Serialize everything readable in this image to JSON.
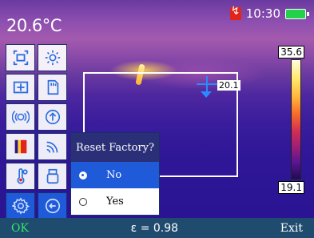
{
  "header": {
    "center_temp": "20.6°C",
    "time": "10:30",
    "sd_icon": "sd-card-icon",
    "battery_icon": "battery-icon"
  },
  "measurement": {
    "spot_value": "20.1"
  },
  "scale": {
    "max": "35.6",
    "min": "19.1"
  },
  "menu_icons": [
    "area-measure-icon",
    "brightness-icon",
    "center-spot-icon",
    "sd-card-icon",
    "emissivity-icon",
    "upload-icon",
    "palette-icon",
    "wifi-icon",
    "temperature-unit-icon",
    "usb-storage-icon",
    "settings-gear-icon",
    "back-icon"
  ],
  "reset_dialog": {
    "title": "Reset Factory?",
    "options": [
      "No",
      "Yes"
    ],
    "selected": "No"
  },
  "bottom_bar": {
    "ok": "OK",
    "emissivity": "ε = 0.98",
    "exit": "Exit"
  },
  "colors": {
    "selected_blue": "#1f5ad9",
    "dialog_title_bg": "#2a2f77",
    "bottom_bar_bg": "#1f4b6e",
    "ok_green": "#35e86a"
  }
}
